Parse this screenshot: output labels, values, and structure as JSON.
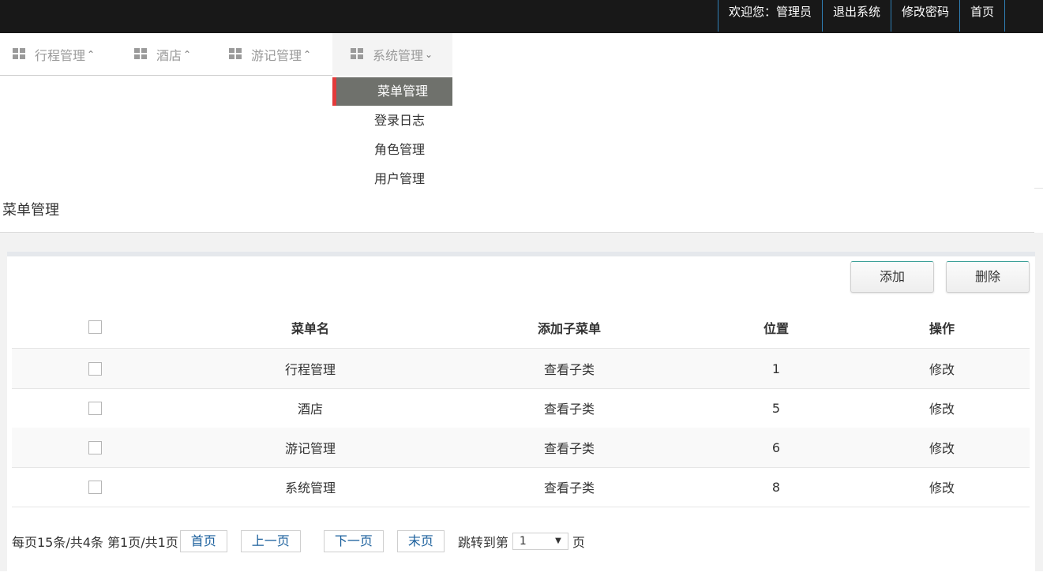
{
  "topbar": {
    "welcome": "欢迎您：管理员",
    "logout": "退出系统",
    "change_password": "修改密码",
    "home": "首页"
  },
  "nav": {
    "items": [
      {
        "label": "行程管理",
        "caret": "^"
      },
      {
        "label": "酒店",
        "caret": "^"
      },
      {
        "label": "游记管理",
        "caret": "^"
      },
      {
        "label": "系统管理",
        "caret": "v"
      }
    ],
    "submenu": [
      "菜单管理",
      "登录日志",
      "角色管理",
      "用户管理"
    ]
  },
  "page": {
    "title": "菜单管理"
  },
  "actions": {
    "add": "添加",
    "delete": "删除"
  },
  "table": {
    "headers": [
      "菜单名",
      "添加子菜单",
      "位置",
      "操作"
    ],
    "rows": [
      {
        "name": "行程管理",
        "sub": "查看子类",
        "pos": "1",
        "op": "修改"
      },
      {
        "name": "酒店",
        "sub": "查看子类",
        "pos": "5",
        "op": "修改"
      },
      {
        "name": "游记管理",
        "sub": "查看子类",
        "pos": "6",
        "op": "修改"
      },
      {
        "name": "系统管理",
        "sub": "查看子类",
        "pos": "8",
        "op": "修改"
      }
    ]
  },
  "pager": {
    "summary": "每页15条/共4条 第1页/共1页",
    "first": "首页",
    "prev": "上一页",
    "next": "下一页",
    "last": "末页",
    "jump_label": "跳转到第",
    "jump_value": "1",
    "jump_suffix": "页"
  },
  "colors": {
    "topbar": "#181818",
    "active_submenu": "#6f716c",
    "accent": "#e23a3a",
    "link": "#1a5f9c"
  }
}
